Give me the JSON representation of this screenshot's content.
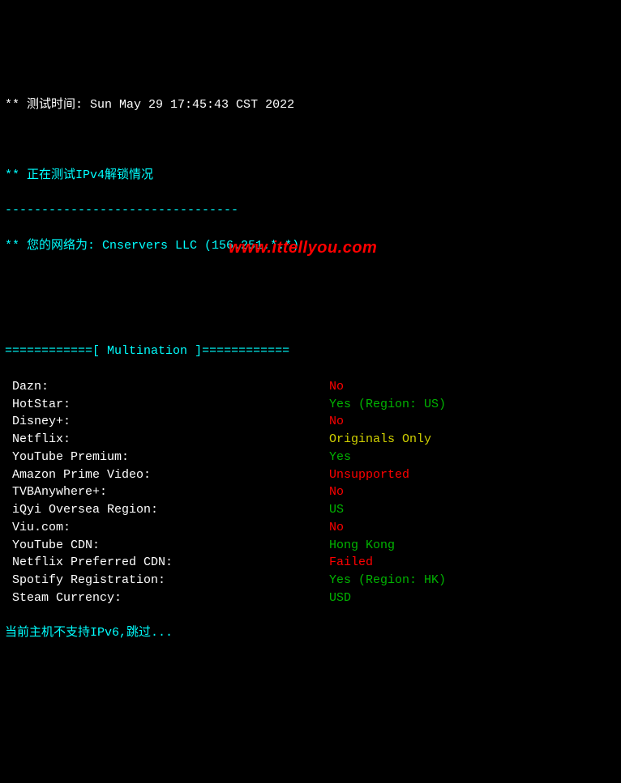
{
  "header": {
    "asterisks": "**",
    "test_time_label": " 测试时间: ",
    "test_time_value": "Sun May 29 17:45:43 CST 2022",
    "testing_ipv4": " 正在测试IPv4解锁情况",
    "dashes": "--------------------------------",
    "network_label": " 您的网络为: ",
    "network_value": "Cnservers LLC (156.251.*.*)"
  },
  "section": {
    "divider_prefix": "============[ ",
    "title": "Multination",
    "divider_suffix": " ]============"
  },
  "rows": [
    {
      "label": " Dazn:",
      "value": "No",
      "cls": "red"
    },
    {
      "label": " HotStar:",
      "value": "Yes (Region: US)",
      "cls": "green"
    },
    {
      "label": " Disney+:",
      "value": "No",
      "cls": "red"
    },
    {
      "label": " Netflix:",
      "value": "Originals Only",
      "cls": "yellow"
    },
    {
      "label": " YouTube Premium:",
      "value": "Yes",
      "cls": "green"
    },
    {
      "label": " Amazon Prime Video:",
      "value": "Unsupported",
      "cls": "red"
    },
    {
      "label": " TVBAnywhere+:",
      "value": "No",
      "cls": "red"
    },
    {
      "label": " iQyi Oversea Region:",
      "value": "US",
      "cls": "green"
    },
    {
      "label": " Viu.com:",
      "value": "No",
      "cls": "red"
    },
    {
      "label": " YouTube CDN:",
      "value": "Hong Kong",
      "cls": "green"
    },
    {
      "label": " Netflix Preferred CDN:",
      "value": "Failed",
      "cls": "red"
    },
    {
      "label": " Spotify Registration:",
      "value": "Yes (Region: HK)",
      "cls": "green"
    },
    {
      "label": " Steam Currency:",
      "value": "USD",
      "cls": "green"
    }
  ],
  "footer": {
    "ipv6_skip": "当前主机不支持IPv6,跳过..."
  },
  "watermark": "www.ittellyou.com"
}
